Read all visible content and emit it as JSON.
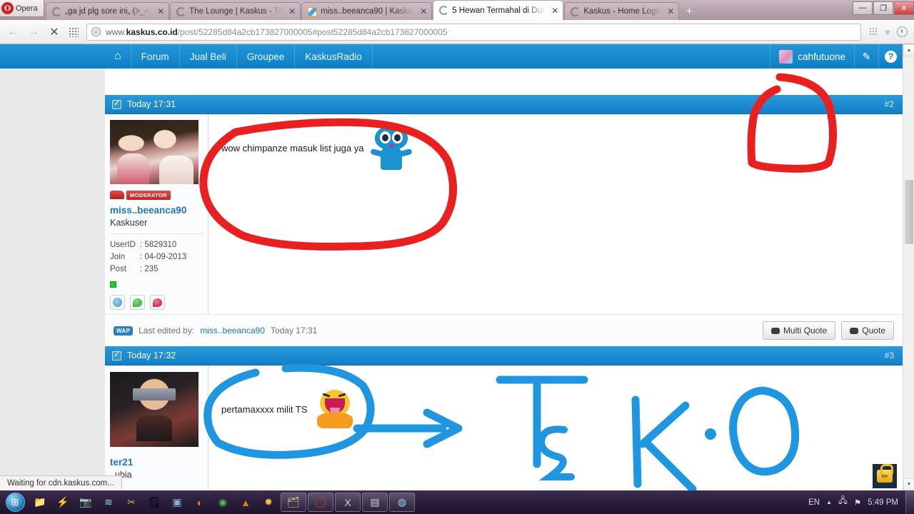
{
  "browser": {
    "brand": "Opera",
    "brand_logo_glyph": "O",
    "tabs": [
      {
        "label": "„ga jd plg sore ini„ (>_<)",
        "icon": "loading-spinner-icon",
        "active": false,
        "close": "✕"
      },
      {
        "label": "The Lounge | Kaskus - The...",
        "icon": "loading-spinner-icon",
        "active": false,
        "close": "✕"
      },
      {
        "label": "miss..beeanca90 | Kaskus",
        "icon": "kaskus-favicon",
        "active": false,
        "close": "✕"
      },
      {
        "label": "5 Hewan Termahal di Dun...",
        "icon": "loading-spinner-icon",
        "active": true,
        "close": "✕"
      },
      {
        "label": "Kaskus - Home Login",
        "icon": "loading-spinner-icon",
        "active": false,
        "close": "✕"
      }
    ],
    "new_tab_label": "+",
    "window_controls": {
      "minimize": "—",
      "maximize": "❐",
      "close": "✕"
    },
    "nav": {
      "back": "←",
      "forward": "→",
      "stop": "✕",
      "speeddial": "grid-icon"
    },
    "url": {
      "scheme_host_pre": "www.",
      "host_bold": "kaskus.co.id",
      "path": "/post/52285d84a2cb173827000005#post52285d84a2cb173827000005",
      "full": "www.kaskus.co.id/post/52285d84a2cb173827000005#post52285d84a2cb173827000005",
      "site_icon_glyph": "◎"
    },
    "status_text": "Waiting for cdn.kaskus.com..."
  },
  "site_nav": {
    "home_glyph": "⌂",
    "items": [
      {
        "label": "Forum"
      },
      {
        "label": "Jual Beli"
      },
      {
        "label": "Groupee"
      },
      {
        "label": "KaskusRadio"
      }
    ],
    "username": "cahfutuone",
    "edit_glyph": "✎",
    "help_glyph": "?"
  },
  "posts": [
    {
      "timestamp": "Today 17:31",
      "number": "#2",
      "checkbox_icon": "checkbox-checked-icon",
      "user": {
        "avatar": "two-girls-photo-avatar",
        "badge": "MODERATOR",
        "badge_icon": "moderator-hat-icon",
        "name": "miss..beeanca90",
        "title": "Kaskuser",
        "stats": [
          {
            "key": "UserID",
            "value": ": 5829310"
          },
          {
            "key": "Join",
            "value": ": 04-09-2013"
          },
          {
            "key": "Post",
            "value": ": 235"
          }
        ],
        "online_status": "online",
        "actions": [
          "profile-icon",
          "add-reputation-icon",
          "report-icon"
        ]
      },
      "text": "wow chimpanze masuk list juga ya",
      "emoticon": "blue-alien-smiley",
      "footer": {
        "wap_badge": "WAP",
        "edited_prefix": "Last edited by:",
        "edited_user": "miss..beeanca90",
        "edited_time": "Today 17:31",
        "multi_quote_label": "Multi Quote",
        "quote_label": "Quote"
      }
    },
    {
      "timestamp": "Today 17:32",
      "number": "#3",
      "checkbox_icon": "checkbox-checked-icon",
      "user": {
        "avatar": "itachi-anime-avatar",
        "name": "ter21",
        "title": "..ubia"
      },
      "text": "pertamaxxxx milit TS",
      "emoticon": "yellow-laughing-smiley"
    }
  ],
  "annotations": [
    {
      "id": "red-circle-post2",
      "color": "#e8201f",
      "shape": "freehand-ellipse"
    },
    {
      "id": "red-bracket-postnum",
      "color": "#e8201f",
      "shape": "freehand-bracket"
    },
    {
      "id": "blue-circle-post3",
      "color": "#2196e0",
      "shape": "freehand-ellipse"
    },
    {
      "id": "blue-arrow",
      "color": "#2196e0",
      "shape": "arrow"
    },
    {
      "id": "blue-text-ts-ko",
      "color": "#2196e0",
      "shape": "handwriting",
      "text": "TS K.O"
    }
  ],
  "lock_badge": {
    "label": "tor",
    "icon": "padlock-icon"
  },
  "taskbar": {
    "start_glyph": "⊞",
    "pinned": [
      "folder-icon",
      "flash-icon",
      "camera-icon",
      "feed-icon",
      "scissors-icon",
      "notepad-icon",
      "media-icon",
      "firefox-icon",
      "chrome-icon",
      "vlc-icon",
      "yellow-app-icon"
    ],
    "running": [
      "explorer-window-icon",
      "opera-window-icon",
      "excel-window-icon",
      "reader-window-icon",
      "app-window-icon"
    ],
    "tray": {
      "language": "EN",
      "expand_glyph": "▲",
      "network_icon": "network-icon",
      "action_center_icon": "flag-warning-icon",
      "clock": "5:49 PM"
    }
  }
}
